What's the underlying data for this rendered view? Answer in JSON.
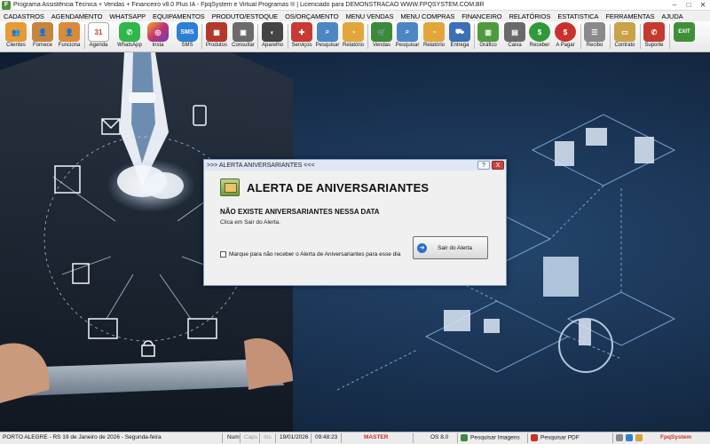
{
  "window": {
    "title": "Programa Assistência Técnica + Vendas + Financeiro v8.0 Plus IA - FpqSystem e Virtual Programas ® | Licenciado para  DEMONSTRACAO WWW.FPQSYSTEM.COM.BR"
  },
  "menu": [
    "CADASTROS",
    "AGENDAMENTO",
    "WHATSAPP",
    "EQUIPAMENTOS",
    "PRODUTO/ESTOQUE",
    "OS/ORÇAMENTO",
    "MENU VENDAS",
    "MENU COMPRAS",
    "FINANCEIRO",
    "RELATÓRIOS",
    "ESTATISTICA",
    "FERRAMENTAS",
    "AJUDA"
  ],
  "toolbar": [
    {
      "label": "Clientes",
      "icon": "clients-icon",
      "color": "#e79a36"
    },
    {
      "label": "Fornece",
      "icon": "supplier-icon",
      "color": "#c9843c"
    },
    {
      "label": "Funciona",
      "icon": "employee-icon",
      "color": "#d98b3a"
    },
    {
      "label": "Agenda",
      "icon": "calendar-icon",
      "color": "#d23a2e"
    },
    {
      "label": "WhatsApp",
      "icon": "whatsapp-icon",
      "color": "#2fb84a"
    },
    {
      "label": "Insta",
      "icon": "instagram-icon",
      "color": "#c1356f"
    },
    {
      "label": "SMS",
      "icon": "sms-icon",
      "color": "#2d7fd3"
    },
    {
      "label": "Produtos",
      "icon": "products-icon",
      "color": "#b23a2c"
    },
    {
      "label": "Consultar",
      "icon": "lookup-icon",
      "color": "#6a6a6a"
    },
    {
      "label": "Aparelho",
      "icon": "device-icon",
      "color": "#444444"
    },
    {
      "label": "Serviços",
      "icon": "services-icon",
      "color": "#c83a35"
    },
    {
      "label": "Pesquisar",
      "icon": "search-icon",
      "color": "#4d86c5"
    },
    {
      "label": "Relatório",
      "icon": "report-icon",
      "color": "#e2a63c"
    },
    {
      "label": "Vendas",
      "icon": "cart-icon",
      "color": "#3a8a3a"
    },
    {
      "label": "Pesquisar",
      "icon": "search-icon",
      "color": "#4d86c5"
    },
    {
      "label": "Relatório",
      "icon": "report-icon",
      "color": "#e2a63c"
    },
    {
      "label": "Entrega",
      "icon": "delivery-icon",
      "color": "#3b6fb6"
    },
    {
      "label": "Gráfico",
      "icon": "chart-icon",
      "color": "#4f9a3e"
    },
    {
      "label": "Caixa",
      "icon": "cash-register-icon",
      "color": "#6a6a6a"
    },
    {
      "label": "Receber",
      "icon": "receive-money-icon",
      "color": "#2e9a3b"
    },
    {
      "label": "A Pagar",
      "icon": "pay-money-icon",
      "color": "#c8312d"
    },
    {
      "label": "Recibo",
      "icon": "receipt-icon",
      "color": "#8a8a8a"
    },
    {
      "label": "Contrato",
      "icon": "contract-icon",
      "color": "#c9a24a"
    },
    {
      "label": "Suporte",
      "icon": "support-icon",
      "color": "#c43a2f"
    },
    {
      "label": "",
      "icon": "exit-icon",
      "color": "#3f8f3a"
    }
  ],
  "dialog": {
    "title": ">>> ALERTA ANIVERSARIANTES <<<",
    "heading": "ALERTA DE ANIVERSARIANTES",
    "message": "NÃO EXISTE ANIVERSARIANTES NESSA DATA",
    "hint": "Clica em Sair do Alerta.",
    "checkbox_label": "Marque para não receber o Alerta de Aniversariantes para esse dia",
    "checkbox_checked": false,
    "button_label": "Sair do Alerta",
    "help_glyph": "?",
    "close_glyph": "X"
  },
  "status": {
    "location_date": "PORTO ALEGRE - RS 19 de Janeiro de 2026 - Segunda-feira",
    "num": "Num",
    "caps": "Caps",
    "ins": "Ins",
    "date": "19/01/2026",
    "time": "09:48:23",
    "user": "MASTER",
    "os": "OS 8.0",
    "search_images": "Pesquisar Imagens",
    "search_pdf": "Pesquisar PDF",
    "brand": "FpqSystem"
  }
}
